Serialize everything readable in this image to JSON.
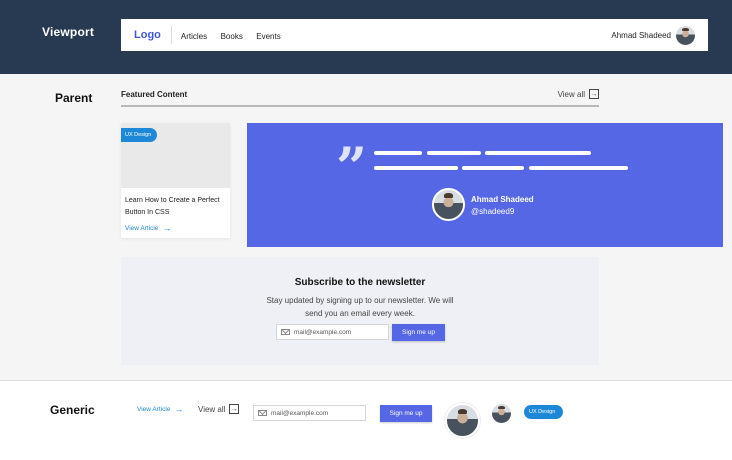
{
  "viewport": {
    "label": "Viewport",
    "header": {
      "logo": "Logo",
      "nav": [
        "Articles",
        "Books",
        "Events"
      ],
      "user_name": "Ahmad Shadeed"
    }
  },
  "parent": {
    "label": "Parent",
    "section_title": "Featured Content",
    "view_all": "View all",
    "card": {
      "tag": "UX Design",
      "title": "Learn How to Create a Perfect Button In CSS",
      "link": "View Article"
    },
    "quote": {
      "name": "Ahmad Shadeed",
      "handle": "@shadeed9"
    },
    "newsletter": {
      "title": "Subscribe to the newsletter",
      "description": "Stay updated by signing up to our newsletter. We will send you an email every week.",
      "email_placeholder": "mail@example.com",
      "button": "Sign me up"
    }
  },
  "generic": {
    "label": "Generic",
    "link": "View Article",
    "view_all": "View all",
    "email_placeholder": "mail@example.com",
    "button": "Sign me up",
    "tag": "UX Design"
  },
  "icons": {
    "arrow": "arrow-right-icon",
    "boxed_arrow": "boxed-arrow-icon",
    "mail": "mail-icon",
    "quote": "quote-icon"
  },
  "colors": {
    "viewport_band": "#283a52",
    "accent": "#5567e4",
    "logo": "#3e57d6",
    "link": "#1e88d8",
    "tag": "#1e88d8"
  }
}
